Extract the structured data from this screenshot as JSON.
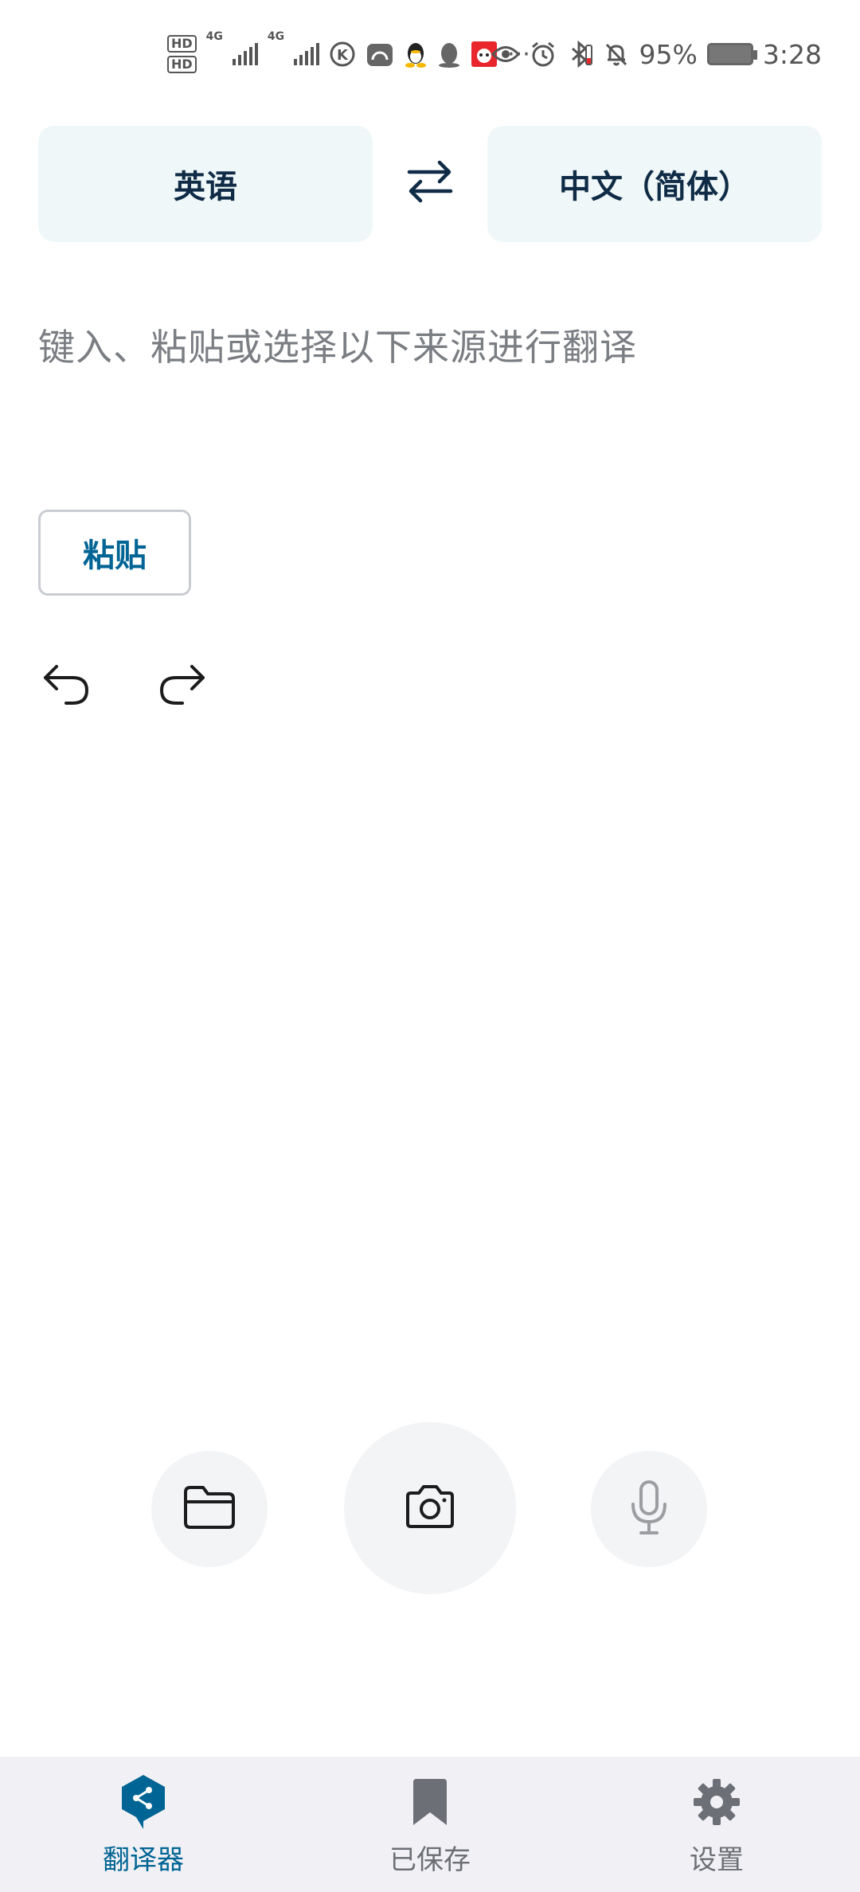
{
  "status_bar": {
    "hd1": "HD",
    "hd2": "HD",
    "net1": "4G",
    "net2": "4G",
    "more": "···",
    "battery_percent": "95%",
    "time": "3:28"
  },
  "languages": {
    "source": "英语",
    "target": "中文（简体）"
  },
  "input": {
    "placeholder": "键入、粘贴或选择以下来源进行翻译"
  },
  "paste_button": "粘贴",
  "bottom_nav": {
    "items": [
      {
        "label": "翻译器",
        "icon": "deepl-logo-icon",
        "active": true
      },
      {
        "label": "已保存",
        "icon": "bookmark-icon",
        "active": false
      },
      {
        "label": "设置",
        "icon": "gear-icon",
        "active": false
      }
    ]
  },
  "colors": {
    "accent": "#006494",
    "lang_box_bg": "#eff7f8",
    "circle_bg": "#f3f4f6",
    "nav_bg": "#f1f1f5",
    "placeholder_text": "#7a7d82"
  }
}
